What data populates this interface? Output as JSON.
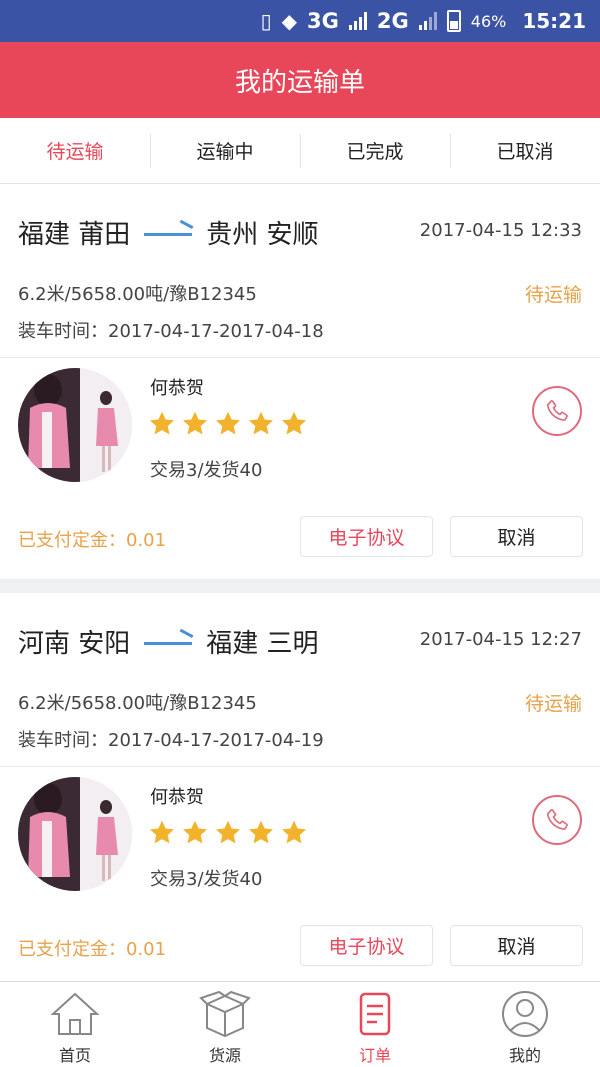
{
  "status_bar": {
    "network_3g": "3G",
    "network_2g": "2G",
    "battery": "46%",
    "time": "15:21"
  },
  "header": {
    "title": "我的运输单"
  },
  "tabs": [
    {
      "label": "待运输",
      "active": true
    },
    {
      "label": "运输中",
      "active": false
    },
    {
      "label": "已完成",
      "active": false
    },
    {
      "label": "已取消",
      "active": false
    }
  ],
  "orders": [
    {
      "from": "福建 莆田",
      "to": "贵州 安顺",
      "time": "2017-04-15 12:33",
      "info": "6.2米/5658.00吨/豫B12345",
      "status": "待运输",
      "load_time": "装车时间：2017-04-17-2017-04-18",
      "driver_name": "何恭贺",
      "rating": 5,
      "stats": "交易3/发货40",
      "deposit": "已支付定金：0.01",
      "contract_label": "电子协议",
      "cancel_label": "取消"
    },
    {
      "from": "河南 安阳",
      "to": "福建 三明",
      "time": "2017-04-15 12:27",
      "info": "6.2米/5658.00吨/豫B12345",
      "status": "待运输",
      "load_time": "装车时间：2017-04-17-2017-04-19",
      "driver_name": "何恭贺",
      "rating": 5,
      "stats": "交易3/发货40",
      "deposit": "已支付定金：0.01",
      "contract_label": "电子协议",
      "cancel_label": "取消"
    }
  ],
  "bottom_nav": [
    {
      "label": "首页",
      "icon": "home-icon",
      "active": false
    },
    {
      "label": "货源",
      "icon": "box-icon",
      "active": false
    },
    {
      "label": "订单",
      "icon": "order-icon",
      "active": true
    },
    {
      "label": "我的",
      "icon": "user-icon",
      "active": false
    }
  ],
  "colors": {
    "status_bar": "#3a53a4",
    "header": "#e8475a",
    "accent": "#e8475a",
    "status": "#e8a24a",
    "star": "#f2b22c",
    "arrow": "#4a90d9"
  }
}
